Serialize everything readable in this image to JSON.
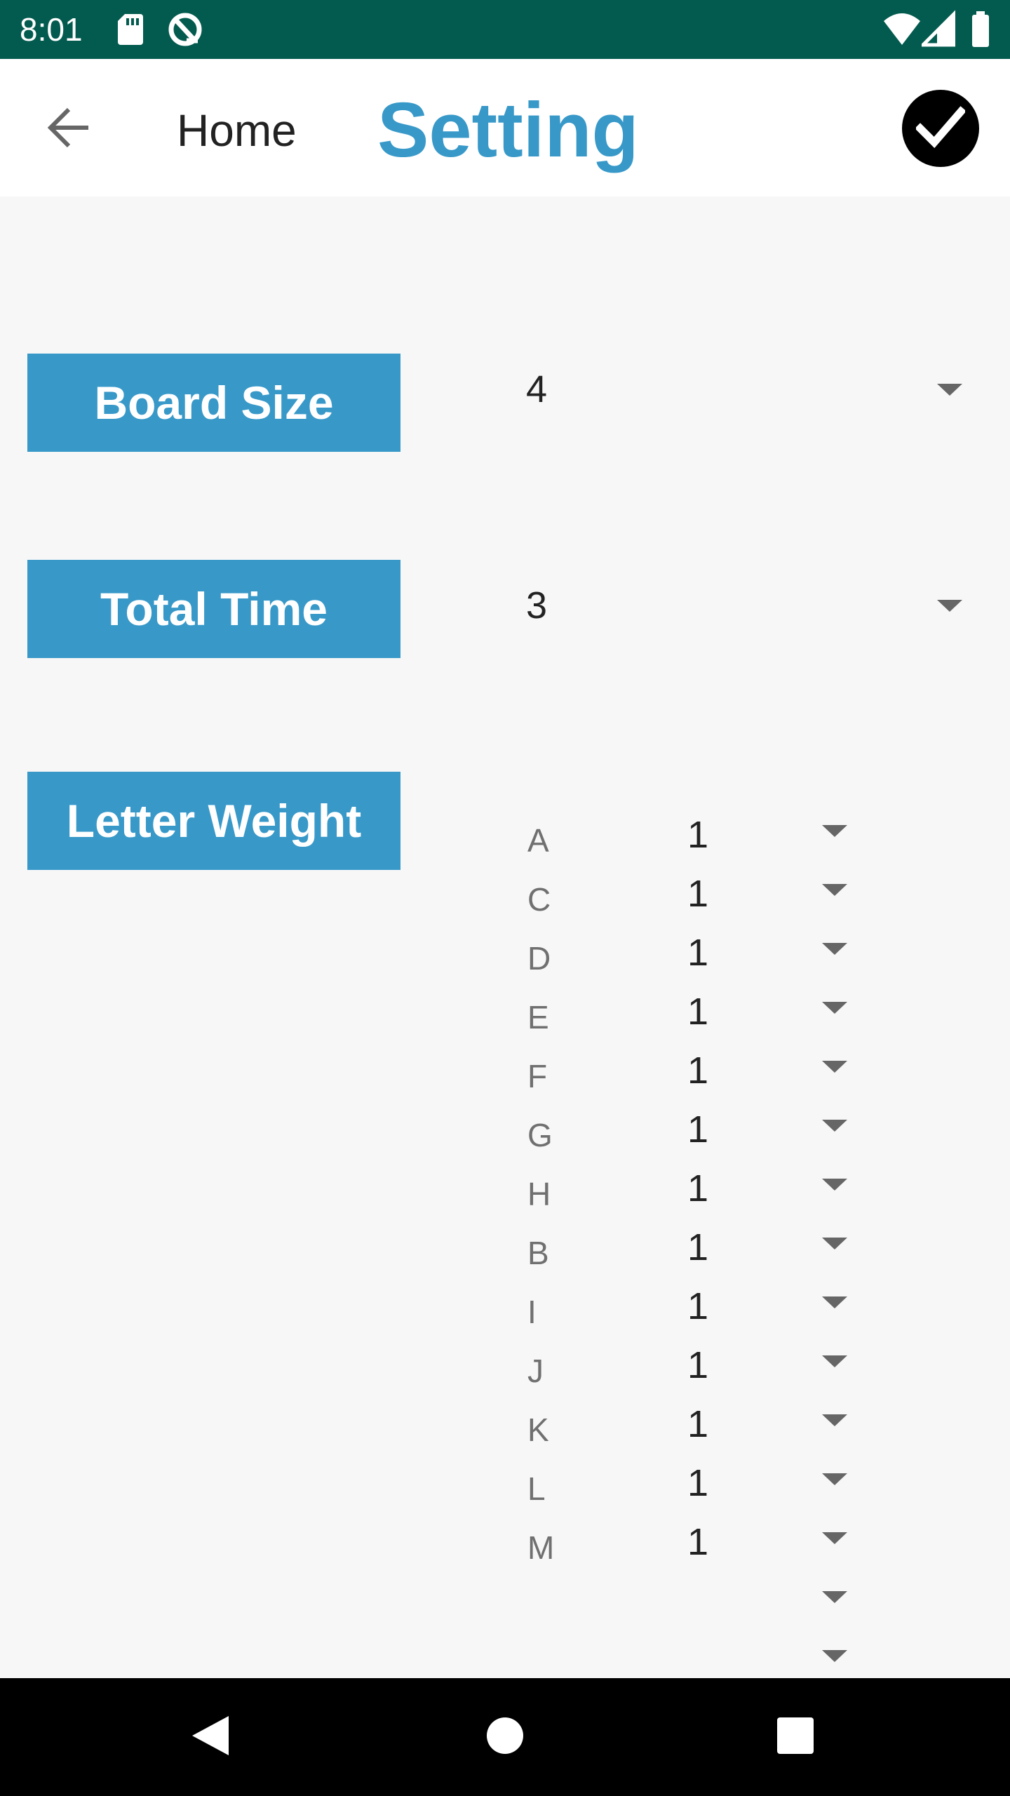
{
  "status_bar": {
    "time": "8:01",
    "icons": [
      "sd-card-icon",
      "sync-icon",
      "wifi-icon",
      "signal-icon",
      "battery-icon"
    ]
  },
  "app_bar": {
    "back_icon": "arrow-left-icon",
    "home_label": "Home",
    "title": "Setting",
    "confirm_icon": "check-circle-icon"
  },
  "settings": {
    "board_size": {
      "label": "Board Size",
      "value": "4"
    },
    "total_time": {
      "label": "Total Time",
      "value": "3"
    },
    "letter_weight": {
      "label": "Letter Weight"
    }
  },
  "letter_weights": [
    {
      "letter": "A",
      "value": "1"
    },
    {
      "letter": "C",
      "value": "1"
    },
    {
      "letter": "D",
      "value": "1"
    },
    {
      "letter": "E",
      "value": "1"
    },
    {
      "letter": "F",
      "value": "1"
    },
    {
      "letter": "G",
      "value": "1"
    },
    {
      "letter": "H",
      "value": "1"
    },
    {
      "letter": "B",
      "value": "1"
    },
    {
      "letter": "I",
      "value": "1"
    },
    {
      "letter": "J",
      "value": "1"
    },
    {
      "letter": "K",
      "value": "1"
    },
    {
      "letter": "L",
      "value": "1"
    },
    {
      "letter": "M",
      "value": "1"
    },
    {
      "letter": "",
      "value": ""
    },
    {
      "letter": "",
      "value": ""
    }
  ],
  "nav_bar": {
    "icons": [
      "nav-back-icon",
      "nav-home-icon",
      "nav-recents-icon"
    ]
  },
  "colors": {
    "status_bar": "#035b4f",
    "accent": "#3899c9",
    "background": "#f7f7f7"
  }
}
